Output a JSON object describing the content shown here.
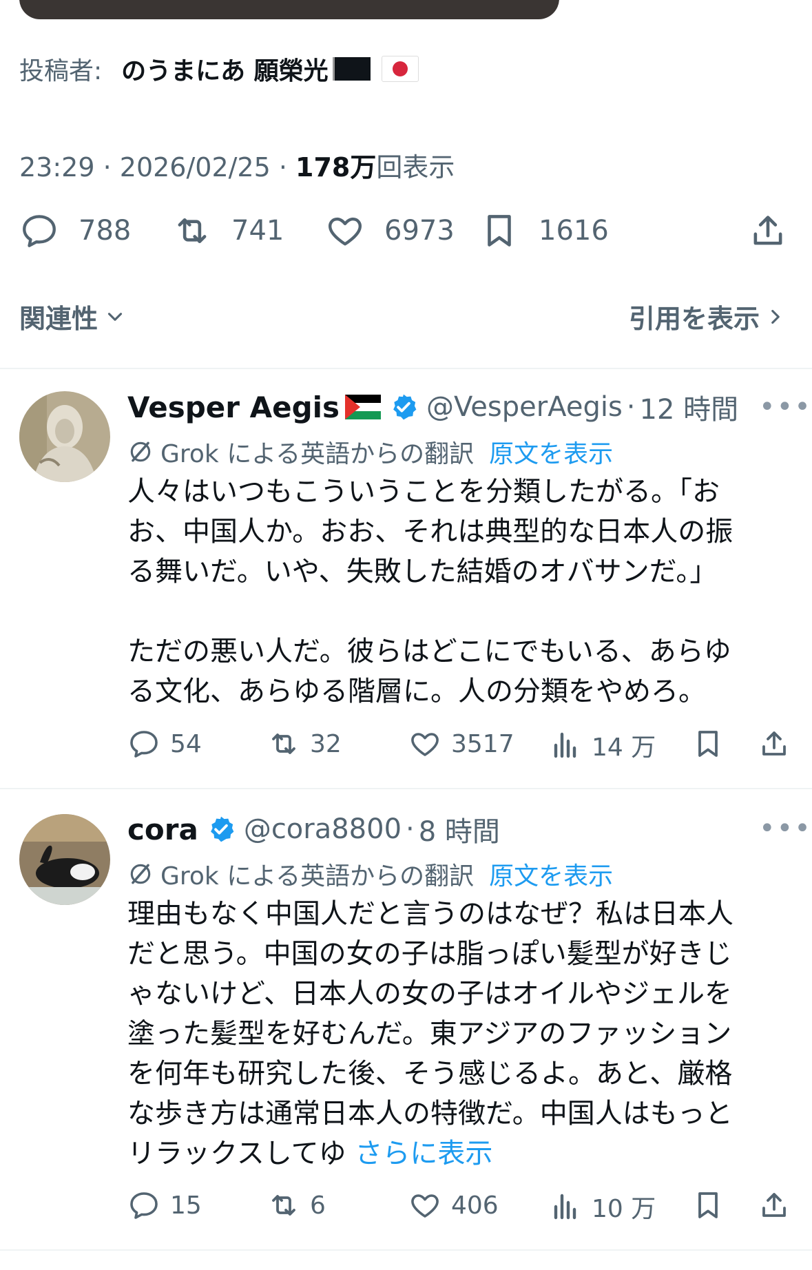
{
  "post": {
    "poster_label": "投稿者:",
    "poster_name": "のうまにあ 願榮光",
    "time": "23:29",
    "date": "2026/02/25",
    "views_count": "178",
    "views_unit": "万",
    "views_label": "回表示",
    "stats": {
      "replies": "788",
      "reposts": "741",
      "likes": "6973",
      "bookmarks": "1616"
    },
    "sort_label": "関連性",
    "quotes_label": "引用を表示"
  },
  "replies": [
    {
      "name": "Vesper Aegis",
      "handle": "@VesperAegis",
      "time": "12 時間",
      "translation_note": "Grok による英語からの翻訳",
      "show_original": "原文を表示",
      "text_lines": [
        "人々はいつもこういうことを分類したがる。「お",
        "お、中国人か。おお、それは典型的な日本人の振",
        "る舞いだ。いや、失敗した結婚のオバサンだ。」",
        "",
        "ただの悪い人だ。彼らはどこにでもいる、あらゆ",
        "る文化、あらゆる階層に。人の分類をやめろ。"
      ],
      "stats": {
        "replies": "54",
        "reposts": "32",
        "likes": "3517",
        "views": "14 万"
      }
    },
    {
      "name": "cora",
      "handle": "@cora8800",
      "time": "8 時間",
      "translation_note": "Grok による英語からの翻訳",
      "show_original": "原文を表示",
      "text_lines": [
        "理由もなく中国人だと言うのはなぜ？私は日本人",
        "だと思う。中国の女の子は脂っぽい髪型が好きじ",
        "ゃないけど、日本人の女の子はオイルやジェルを",
        "塗った髪型を好むんだ。東アジアのファッション",
        "を何年も研究した後、そう感じるよ。あと、厳格",
        "な歩き方は通常日本人の特徴だ。中国人はもっと"
      ],
      "last_line": "リラックスしてゆ",
      "show_more": "さらに表示",
      "stats": {
        "replies": "15",
        "reposts": "6",
        "likes": "406",
        "views": "10 万"
      }
    }
  ],
  "colors": {
    "accent": "#1d9bf0",
    "secondary_text": "#536471",
    "primary_text": "#0f1419"
  }
}
